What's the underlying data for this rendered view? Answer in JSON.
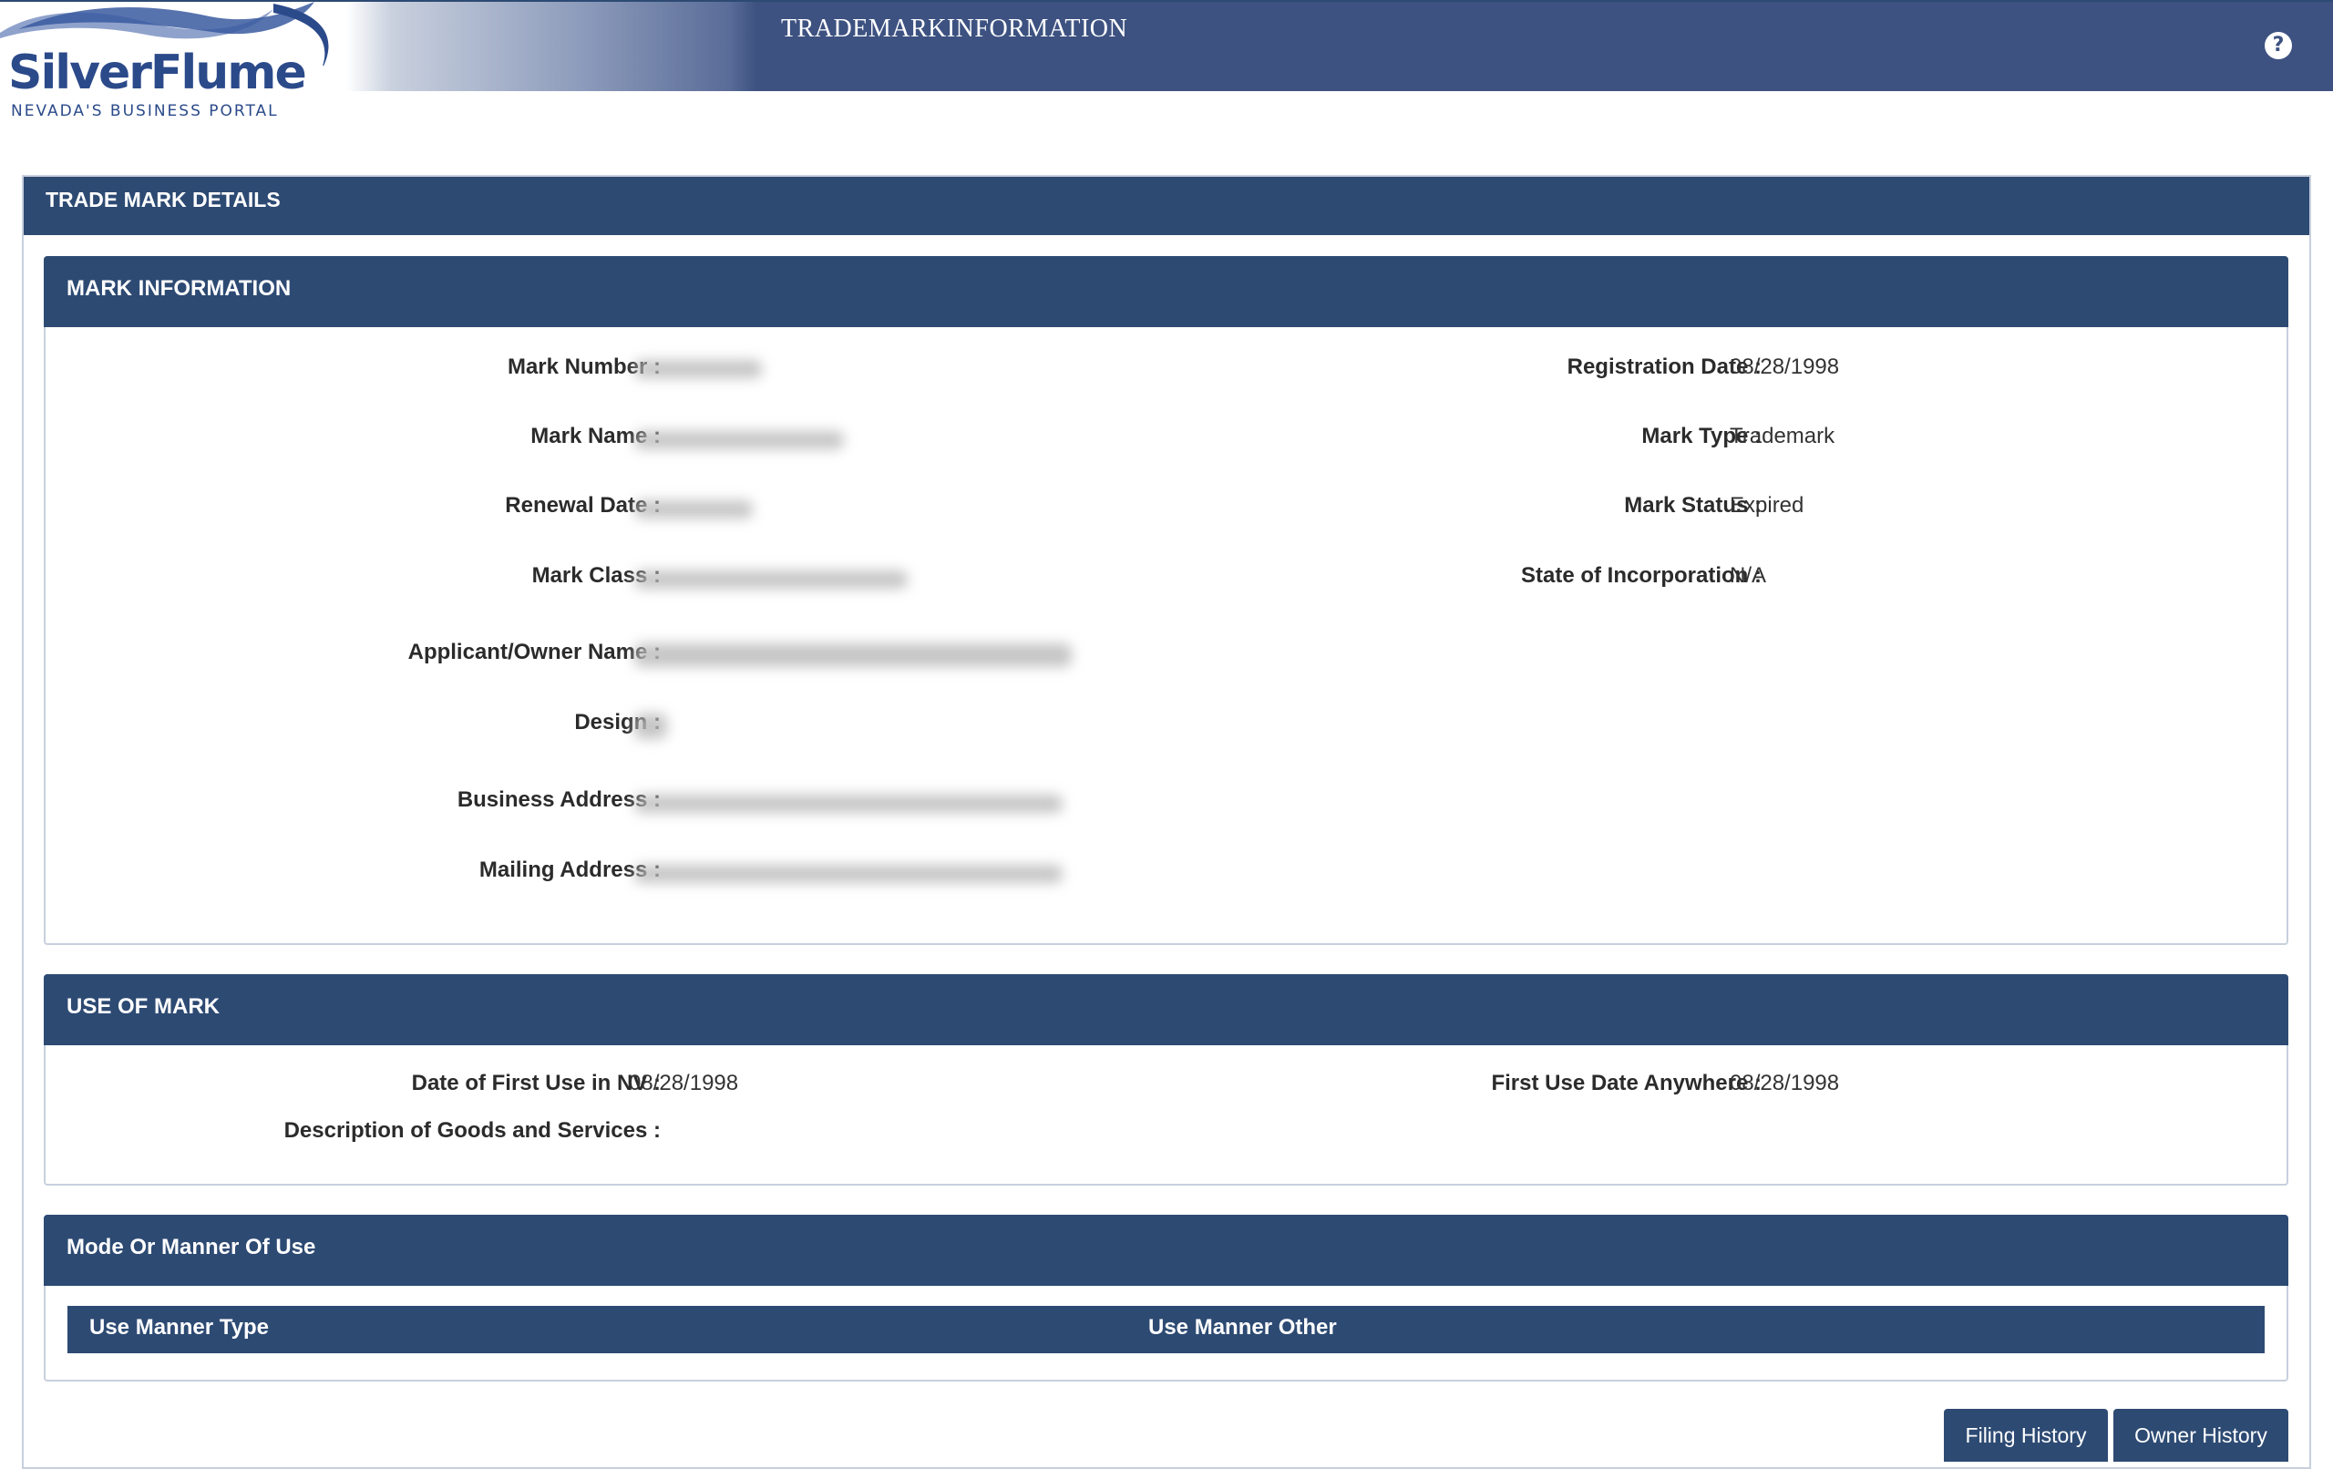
{
  "header": {
    "logo_name": "SilverFlume",
    "logo_tagline": "NEVADA'S BUSINESS PORTAL",
    "title": "TRADEMARKINFORMATION",
    "help_icon": "question-circle-icon",
    "help_symbol": "?"
  },
  "panel_title": "TRADE MARK DETAILS",
  "mark_information": {
    "title": "MARK INFORMATION",
    "left": [
      {
        "label": "Mark Number :",
        "value": ""
      },
      {
        "label": "Mark Name :",
        "value": ""
      },
      {
        "label": "Renewal Date :",
        "value": ""
      },
      {
        "label": "Mark Class :",
        "value": ""
      },
      {
        "label": "Applicant/Owner Name :",
        "value": ""
      },
      {
        "label": "Design :",
        "value": ""
      },
      {
        "label": "Business Address :",
        "value": ""
      },
      {
        "label": "Mailing Address :",
        "value": ""
      }
    ],
    "right": [
      {
        "label": "Registration Date :",
        "value": "08/28/1998"
      },
      {
        "label": "Mark Type :",
        "value": "Trademark"
      },
      {
        "label": "Mark Status :",
        "value": "Expired"
      },
      {
        "label": "State of Incorporation :",
        "value": "N/A"
      }
    ]
  },
  "use_of_mark": {
    "title": "USE OF MARK",
    "first_use_nv_label": "Date of First Use in NV :",
    "first_use_nv_value": "08/28/1998",
    "first_use_anywhere_label": "First Use Date Anywhere :",
    "first_use_anywhere_value": "08/28/1998",
    "description_label": "Description of Goods and Services :",
    "description_value": ""
  },
  "mode_of_use": {
    "title": "Mode Or Manner Of Use",
    "columns": [
      "Use Manner Type",
      "Use Manner Other"
    ]
  },
  "buttons": {
    "filing_history": "Filing History",
    "owner_history": "Owner History"
  },
  "colors": {
    "primary": "#2d4a73",
    "header_bar": "#3d5281",
    "border": "#c8d0dd"
  }
}
